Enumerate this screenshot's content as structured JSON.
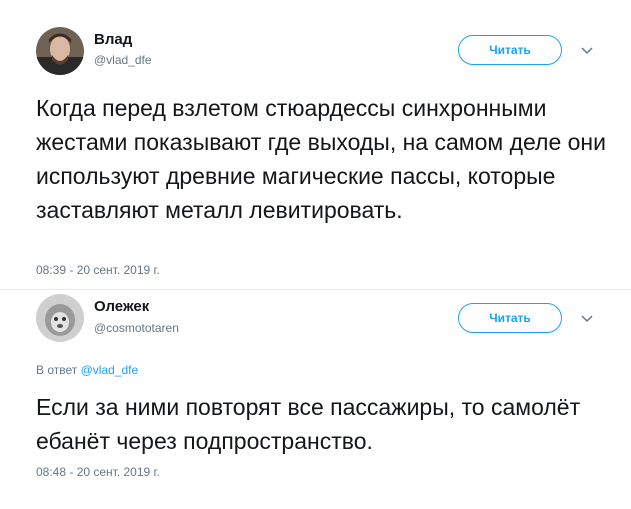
{
  "tweets": [
    {
      "author_name": "Влад",
      "author_handle": "@vlad_dfe",
      "follow_label": "Читать",
      "text": "Когда перед взлетом стюардессы синхронными жестами показывают где выходы, на самом деле они используют древние магические пассы, которые заставляют металл левитировать.",
      "timestamp": "08:39 - 20 сент. 2019 г."
    },
    {
      "author_name": "Олежек",
      "author_handle": "@cosmototaren",
      "follow_label": "Читать",
      "reply_prefix": "В ответ",
      "reply_to": "@vlad_dfe",
      "text": "Если за ними повторят все пассажиры, то самолёт ебанёт через подпространство.",
      "timestamp": "08:48 - 20 сент. 2019 г."
    }
  ],
  "colors": {
    "accent": "#1da1f2",
    "secondary_text": "#657786",
    "divider": "#e6ecf0"
  }
}
